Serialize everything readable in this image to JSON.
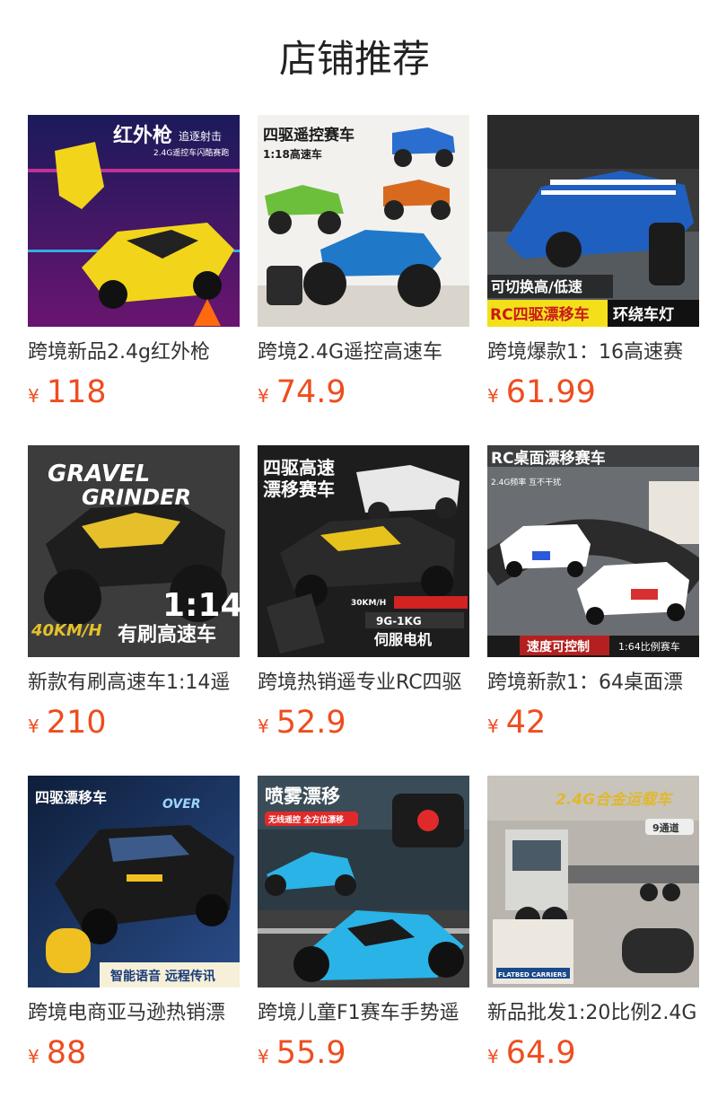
{
  "page": {
    "title": "店铺推荐"
  },
  "currency_symbol": "¥",
  "products": [
    {
      "name": "跨境新品2.4g红外枪",
      "price": "118",
      "image": {
        "bg": "#2a0f4a",
        "accent": "#f2d51a",
        "accent2": "#ff3cac",
        "caption": "红外枪",
        "caption2": "追逐射击",
        "caption3": "2.4G遥控车闪酷赛跑",
        "caption_bar": "",
        "icon": "toy-car-icon"
      }
    },
    {
      "name": "跨境2.4G遥控高速车",
      "price": "74.9",
      "image": {
        "bg": "#f3f1ee",
        "accent": "#2a84d8",
        "accent2": "#7cc040",
        "caption": "四驱遥控赛车",
        "caption2": "1:18高速车",
        "caption3": "",
        "caption_bar": "",
        "icon": "monster-truck-icon"
      }
    },
    {
      "name": "跨境爆款1：16高速赛",
      "price": "61.99",
      "image": {
        "bg": "#3a3a3a",
        "accent": "#1f5fbf",
        "accent2": "#ffffff",
        "caption": "可切换高/低速",
        "caption2": "RC四驱漂移车",
        "caption3": "环绕车灯",
        "caption_bar": "",
        "icon": "muscle-car-icon"
      }
    },
    {
      "name": "新款有刷高速车1:14遥",
      "price": "210",
      "image": {
        "bg": "#3c3c3c",
        "accent": "#e5c02a",
        "accent2": "#ffffff",
        "caption": "GRAVEL",
        "caption2": "GRINDER",
        "caption3": "1:14",
        "caption_bar": "有刷高速车",
        "caption_speed": "40KM/H",
        "icon": "monster-truck-icon"
      }
    },
    {
      "name": "跨境热销遥专业RC四驱",
      "price": "52.9",
      "image": {
        "bg": "#1d1d1d",
        "accent": "#e8c21c",
        "accent2": "#d32222",
        "caption": "四驱高速",
        "caption2": "漂移赛车",
        "caption3": "30KM/H",
        "caption_bar": "9G-1KG",
        "caption_motor": "伺服电机",
        "icon": "sports-car-icon"
      }
    },
    {
      "name": "跨境新款1：64桌面漂",
      "price": "42",
      "image": {
        "bg": "#6a6e72",
        "accent": "#d83030",
        "accent2": "#ffffff",
        "caption": "RC桌面漂移赛车",
        "caption2": "2.4G频率 互不干扰",
        "caption3": "速度可控制",
        "caption_bar": "1:64比例赛车",
        "icon": "race-car-icon"
      }
    },
    {
      "name": "跨境电商亚马逊热销漂",
      "price": "88",
      "image": {
        "bg": "#1a2c4e",
        "accent": "#f0c020",
        "accent2": "#9bd6ff",
        "caption": "四驱漂移车",
        "caption2": "OVER",
        "caption3": "",
        "caption_bar": "智能语音 远程传讯",
        "icon": "police-car-icon"
      }
    },
    {
      "name": "跨境儿童F1赛车手势遥",
      "price": "55.9",
      "image": {
        "bg": "#2c3a44",
        "accent": "#2ab3e6",
        "accent2": "#e02a2a",
        "caption": "喷雾漂移",
        "caption2": "无线遥控 全方位漂移",
        "caption3": "",
        "caption_bar": "",
        "icon": "f1-car-icon"
      }
    },
    {
      "name": "新品批发1:20比例2.4G",
      "price": "64.9",
      "image": {
        "bg": "#b9b5ae",
        "accent": "#e0b830",
        "accent2": "#6b6b6b",
        "caption": "2.4G合金运载车",
        "caption2": "9通道",
        "caption3": "FLATBED CARRIERS",
        "caption_bar": "",
        "icon": "truck-icon"
      }
    }
  ]
}
